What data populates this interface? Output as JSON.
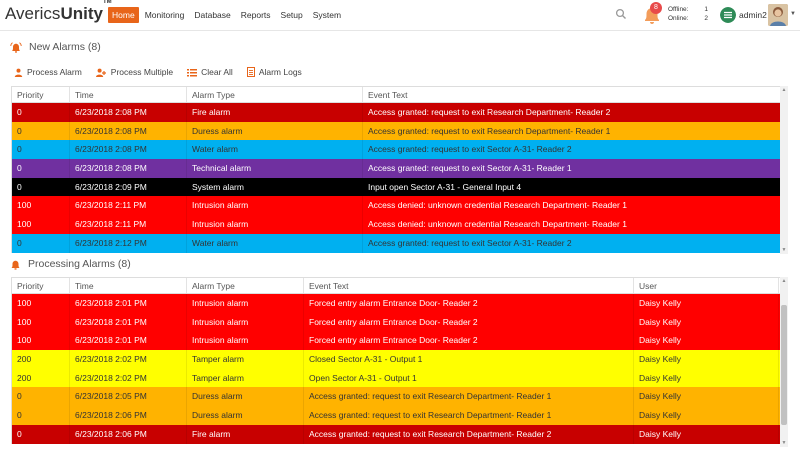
{
  "app": {
    "logo_light": "Averics",
    "logo_bold": "Unity",
    "logo_tm": "TM"
  },
  "nav": {
    "items": [
      {
        "label": "Home",
        "active": true
      },
      {
        "label": "Monitoring",
        "active": false
      },
      {
        "label": "Database",
        "active": false
      },
      {
        "label": "Reports",
        "active": false
      },
      {
        "label": "Setup",
        "active": false
      },
      {
        "label": "System",
        "active": false
      }
    ]
  },
  "header": {
    "notification_count": "8",
    "offline_label": "Offline:",
    "offline_value": "1",
    "online_label": "Online:",
    "online_value": "2",
    "username": "admin2"
  },
  "colors": {
    "accent": "#e8651a",
    "fire": "#c80000",
    "intrusion": "#ff0000",
    "duress": "#ffb300",
    "water": "#00b0f0",
    "technical": "#7030a0",
    "system": "#000000",
    "tamper": "#ffff00"
  },
  "new_alarms": {
    "title": "New Alarms (8)",
    "toolbar": {
      "process_alarm": "Process Alarm",
      "process_multiple": "Process Multiple",
      "clear_all": "Clear All",
      "alarm_logs": "Alarm Logs"
    },
    "columns": {
      "priority": "Priority",
      "time": "Time",
      "alarm_type": "Alarm Type",
      "event_text": "Event Text"
    },
    "rows": [
      {
        "priority": "0",
        "time": "6/23/2018 2:08 PM",
        "alarm_type": "Fire alarm",
        "event_text": "Access granted: request to exit Research Department- Reader 2",
        "color": "darkred"
      },
      {
        "priority": "0",
        "time": "6/23/2018 2:08 PM",
        "alarm_type": "Duress alarm",
        "event_text": "Access granted: request to exit Research Department- Reader 1",
        "color": "orange"
      },
      {
        "priority": "0",
        "time": "6/23/2018 2:08 PM",
        "alarm_type": "Water alarm",
        "event_text": "Access granted: request to exit Sector A-31- Reader 2",
        "color": "blue"
      },
      {
        "priority": "0",
        "time": "6/23/2018 2:08 PM",
        "alarm_type": "Technical alarm",
        "event_text": "Access granted: request to exit Sector A-31- Reader 1",
        "color": "purple"
      },
      {
        "priority": "0",
        "time": "6/23/2018 2:09 PM",
        "alarm_type": "System alarm",
        "event_text": "Input open Sector A-31 - General Input 4",
        "color": "black"
      },
      {
        "priority": "100",
        "time": "6/23/2018 2:11 PM",
        "alarm_type": "Intrusion alarm",
        "event_text": "Access denied: unknown credential Research Department- Reader 1",
        "color": "red"
      },
      {
        "priority": "100",
        "time": "6/23/2018 2:11 PM",
        "alarm_type": "Intrusion alarm",
        "event_text": "Access denied: unknown credential Research Department- Reader 1",
        "color": "red"
      },
      {
        "priority": "0",
        "time": "6/23/2018 2:12 PM",
        "alarm_type": "Water alarm",
        "event_text": "Access granted: request to exit Sector A-31- Reader 2",
        "color": "blue"
      }
    ]
  },
  "processing_alarms": {
    "title": "Processing Alarms (8)",
    "columns": {
      "priority": "Priority",
      "time": "Time",
      "alarm_type": "Alarm Type",
      "event_text": "Event Text",
      "user": "User"
    },
    "rows": [
      {
        "priority": "100",
        "time": "6/23/2018 2:01 PM",
        "alarm_type": "Intrusion alarm",
        "event_text": "Forced entry alarm Entrance Door- Reader 2",
        "user": "Daisy Kelly",
        "color": "red"
      },
      {
        "priority": "100",
        "time": "6/23/2018 2:01 PM",
        "alarm_type": "Intrusion alarm",
        "event_text": "Forced entry alarm Entrance Door- Reader 2",
        "user": "Daisy Kelly",
        "color": "red"
      },
      {
        "priority": "100",
        "time": "6/23/2018 2:01 PM",
        "alarm_type": "Intrusion alarm",
        "event_text": "Forced entry alarm Entrance Door- Reader 2",
        "user": "Daisy Kelly",
        "color": "red"
      },
      {
        "priority": "200",
        "time": "6/23/2018 2:02 PM",
        "alarm_type": "Tamper alarm",
        "event_text": "Closed Sector A-31 - Output 1",
        "user": "Daisy Kelly",
        "color": "yellow"
      },
      {
        "priority": "200",
        "time": "6/23/2018 2:02 PM",
        "alarm_type": "Tamper alarm",
        "event_text": "Open Sector A-31 - Output 1",
        "user": "Daisy Kelly",
        "color": "yellow"
      },
      {
        "priority": "0",
        "time": "6/23/2018 2:05 PM",
        "alarm_type": "Duress alarm",
        "event_text": "Access granted: request to exit Research Department- Reader 1",
        "user": "Daisy Kelly",
        "color": "orange"
      },
      {
        "priority": "0",
        "time": "6/23/2018 2:06 PM",
        "alarm_type": "Duress alarm",
        "event_text": "Access granted: request to exit Research Department- Reader 1",
        "user": "Daisy Kelly",
        "color": "orange"
      },
      {
        "priority": "0",
        "time": "6/23/2018 2:06 PM",
        "alarm_type": "Fire alarm",
        "event_text": "Access granted: request to exit Research Department- Reader 2",
        "user": "Daisy Kelly",
        "color": "darkred"
      }
    ]
  }
}
